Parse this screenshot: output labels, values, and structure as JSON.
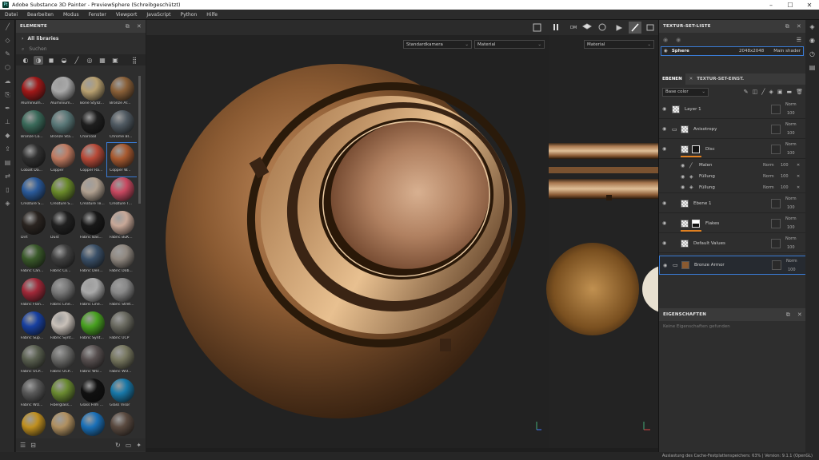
{
  "titlebar": {
    "title": "Adobe Substance 3D Painter - PreviewSphere (Schreibgeschützt)",
    "app_icon": "Pt",
    "minimize": "–",
    "maximize": "☐",
    "close": "✕"
  },
  "menu": [
    "Datei",
    "Bearbeiten",
    "Modus",
    "Fenster",
    "Viewport",
    "JavaScript",
    "Python",
    "Hilfe"
  ],
  "shelf": {
    "title": "ELEMENTE",
    "library": "All libraries",
    "search_placeholder": "Suchen",
    "items": [
      {
        "label": "Aluminium...",
        "color": "#a01818"
      },
      {
        "label": "Aluminium...",
        "color": "#a8a8a8"
      },
      {
        "label": "Bone Styliz...",
        "color": "#b8a070"
      },
      {
        "label": "Bronze Ar...",
        "color": "#8a6038"
      },
      {
        "label": "Bronze Co...",
        "color": "#3a6a5a"
      },
      {
        "label": "Bronze Sta...",
        "color": "#5a7878"
      },
      {
        "label": "Charcoal",
        "color": "#1e1e1e"
      },
      {
        "label": "Chrome Bl...",
        "color": "#505a62"
      },
      {
        "label": "Cobalt Da...",
        "color": "#303030"
      },
      {
        "label": "Copper",
        "color": "#c07a60"
      },
      {
        "label": "Copper Ra...",
        "color": "#b84a38"
      },
      {
        "label": "Copper W...",
        "color": "#a85a30"
      },
      {
        "label": "Creature S...",
        "color": "#2a5a9a"
      },
      {
        "label": "Creature S...",
        "color": "#6a8a2a"
      },
      {
        "label": "Creature Te...",
        "color": "#b0a090"
      },
      {
        "label": "Creature T...",
        "color": "#c84860"
      },
      {
        "label": "Dirt",
        "color": "#2a2420"
      },
      {
        "label": "Dust",
        "color": "#202020"
      },
      {
        "label": "Fabric Bas...",
        "color": "#181818"
      },
      {
        "label": "Fabric BuK...",
        "color": "#c8a898"
      },
      {
        "label": "Fabric Can...",
        "color": "#3a5a2a"
      },
      {
        "label": "Fabric Co...",
        "color": "#404040"
      },
      {
        "label": "Fabric Den...",
        "color": "#3a5068"
      },
      {
        "label": "Fabric Dob...",
        "color": "#908880"
      },
      {
        "label": "Fabric Flan...",
        "color": "#a02838"
      },
      {
        "label": "Fabric Line...",
        "color": "#787878"
      },
      {
        "label": "Fabric Line...",
        "color": "#a8a8a8"
      },
      {
        "label": "Fabric Stret...",
        "color": "#888888"
      },
      {
        "label": "Fabric Sup...",
        "color": "#1840a0"
      },
      {
        "label": "Fabric Synt...",
        "color": "#c8c0b8"
      },
      {
        "label": "Fabric Synt...",
        "color": "#48a020"
      },
      {
        "label": "Fabric UCP",
        "color": "#6a6a60"
      },
      {
        "label": "Fabric UCP...",
        "color": "#5a6050"
      },
      {
        "label": "Fabric UCP...",
        "color": "#6a6a68"
      },
      {
        "label": "Fabric WO...",
        "color": "#585050"
      },
      {
        "label": "Fabric WO...",
        "color": "#787860"
      },
      {
        "label": "Fabric WO...",
        "color": "#585858"
      },
      {
        "label": "Fiberglass...",
        "color": "#6a8a30"
      },
      {
        "label": "Glass Film ...",
        "color": "#101010"
      },
      {
        "label": "Glass Visor",
        "color": "#1878a8"
      },
      {
        "label": "",
        "color": "#c09020"
      },
      {
        "label": "",
        "color": "#b09060"
      },
      {
        "label": "",
        "color": "#1a70b8"
      },
      {
        "label": "",
        "color": "#5a4a40"
      }
    ]
  },
  "viewport": {
    "camera_select": "Standardkamera",
    "material_select_3d": "Material",
    "material_select_2d": "Material"
  },
  "texture_set_list": {
    "title": "TEXTUR-SET-LISTE",
    "row": {
      "name": "Sphere",
      "resolution": "2048x2048",
      "shader": "Main shader"
    }
  },
  "layers": {
    "tab_layers": "EBENEN",
    "tab_settings": "TEXTUR-SET-EINST.",
    "channel": "Base color",
    "items": [
      {
        "name": "Layer 1",
        "blend": "Norm",
        "opacity": "100"
      },
      {
        "name": "Anisotropy",
        "blend": "Norm",
        "opacity": "100"
      },
      {
        "name": "Disc",
        "blend": "Norm",
        "opacity": "100"
      },
      {
        "name": "Ebene 1",
        "blend": "Norm",
        "opacity": "100"
      },
      {
        "name": "Flakes",
        "blend": "Norm",
        "opacity": "100"
      },
      {
        "name": "Default Values",
        "blend": "Norm",
        "opacity": "100"
      },
      {
        "name": "Bronze Armor",
        "blend": "Norm",
        "opacity": "100"
      }
    ],
    "effects": [
      {
        "name": "Malen",
        "blend": "Norm",
        "opacity": "100"
      },
      {
        "name": "Füllung",
        "blend": "Norm",
        "opacity": "100"
      },
      {
        "name": "Füllung",
        "blend": "Norm",
        "opacity": "100"
      }
    ]
  },
  "properties": {
    "title": "EIGENSCHAFTEN",
    "empty": "Keine Eigenschaften gefunden"
  },
  "status": "Auslastung des Cache-Festplattenspeichers:  63% | Version: 9.1.1 (OpenGL)"
}
